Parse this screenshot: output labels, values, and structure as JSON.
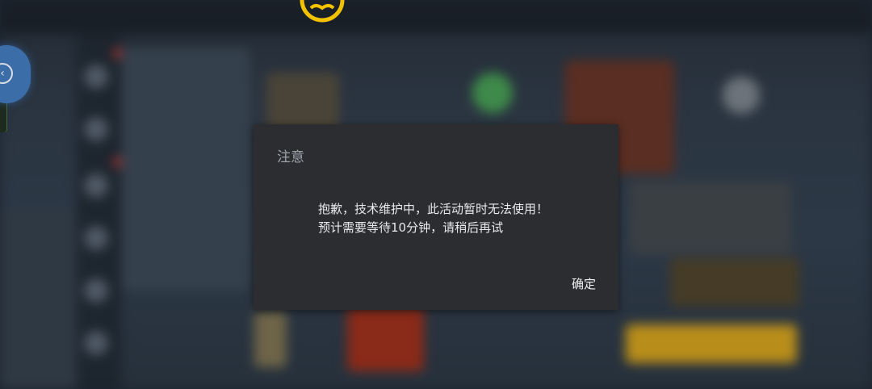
{
  "dialog": {
    "title": "注意",
    "message_line1": "抱歉，技术维护中，此活动暂时无法使用！",
    "message_line2": "预计需要等待10分钟，请稍后再试",
    "confirm_label": "确定"
  },
  "colors": {
    "dialog_bg": "#2b2d31",
    "title_text": "#9ea3aa",
    "message_text": "#e8e9eb",
    "gold_accent": "#f2c200",
    "toggle_blue": "#3b6ea8"
  },
  "icons": {
    "top_logo": "gold-ring-logo-icon",
    "side_toggle": "collapse-arrow-icon"
  }
}
